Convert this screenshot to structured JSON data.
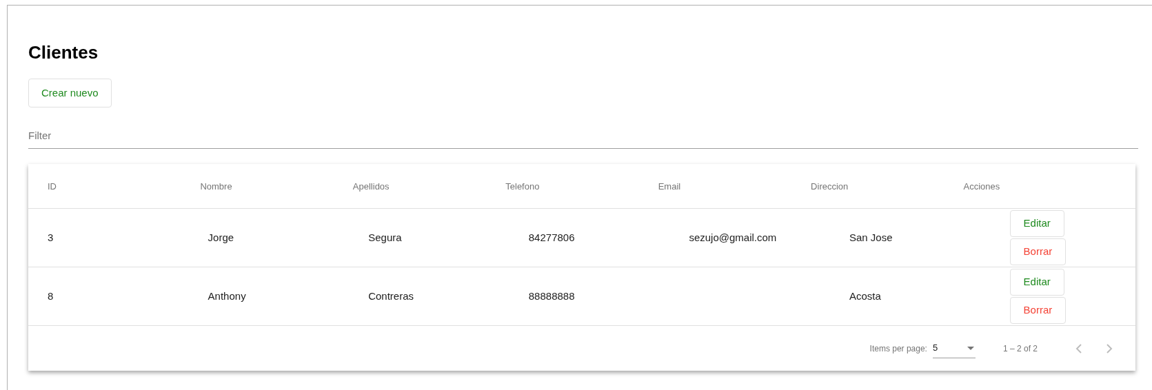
{
  "title": "Clientes",
  "create_button": "Crear nuevo",
  "filter": {
    "placeholder": "Filter"
  },
  "table": {
    "columns": [
      "ID",
      "Nombre",
      "Apellidos",
      "Telefono",
      "Email",
      "Direccion",
      "Acciones"
    ],
    "rows": [
      {
        "cells": [
          "3",
          "Jorge",
          "Segura",
          "84277806",
          "sezujo@gmail.com",
          "San Jose"
        ],
        "actions": [
          {
            "label": "Editar",
            "kind": "edit"
          },
          {
            "label": "Borrar",
            "kind": "delete"
          }
        ]
      },
      {
        "cells": [
          "8",
          "Anthony",
          "Contreras",
          "88888888",
          "",
          "Acosta"
        ],
        "actions": [
          {
            "label": "Editar",
            "kind": "edit"
          },
          {
            "label": "Borrar",
            "kind": "delete"
          }
        ]
      }
    ]
  },
  "paginator": {
    "items_label": "Items per page:",
    "page_size": "5",
    "range": "1 – 2 of 2",
    "prev_disabled": true,
    "next_disabled": true
  }
}
